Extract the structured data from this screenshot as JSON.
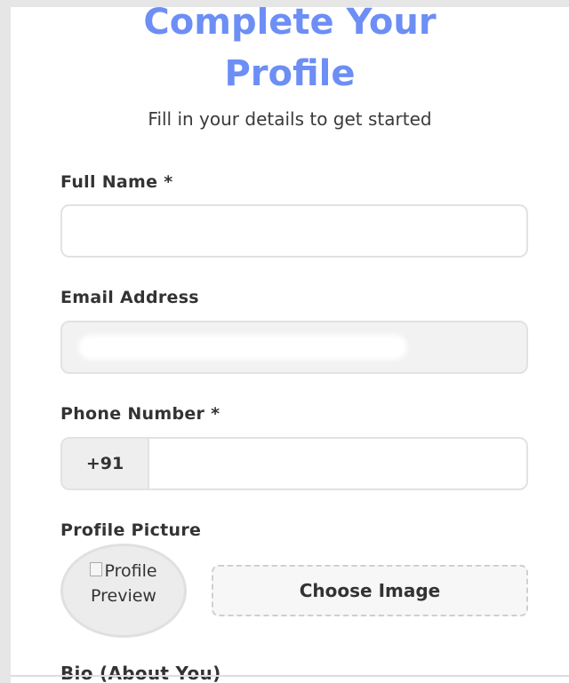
{
  "header": {
    "title_line1": "Complete Your",
    "title_line2": "Profile",
    "subtitle": "Fill in your details to get started"
  },
  "form": {
    "full_name": {
      "label": "Full Name *",
      "value": ""
    },
    "email": {
      "label": "Email Address",
      "value": ""
    },
    "phone": {
      "label": "Phone Number *",
      "prefix": "+91",
      "value": ""
    },
    "profile_picture": {
      "label": "Profile Picture",
      "preview_alt": "Profile Preview",
      "choose_label": "Choose Image"
    },
    "bio": {
      "label": "Bio (About You)"
    }
  },
  "colors": {
    "accent": "#6c8ef5",
    "text": "#333333"
  }
}
